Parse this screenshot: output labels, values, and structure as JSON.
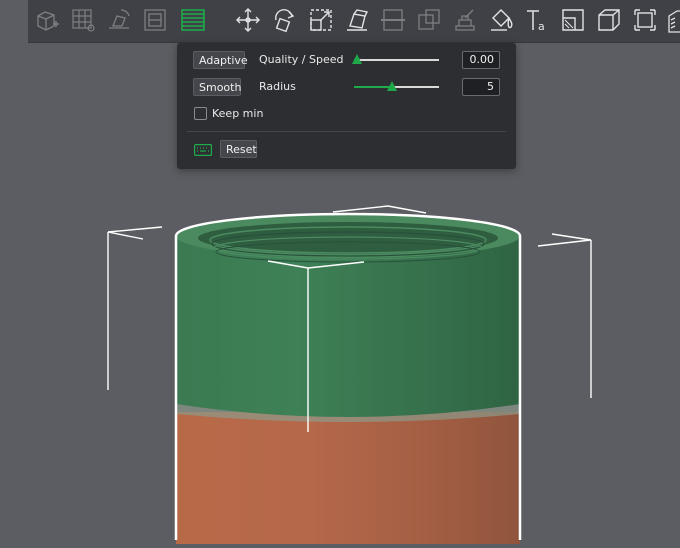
{
  "toolbar": {
    "icons": [
      "add-object-icon",
      "arrange-icon",
      "orient-icon",
      "layers-icon",
      "variable-layer-height-icon",
      "move-icon",
      "rotate-icon",
      "scale-icon",
      "lay-on-face-icon",
      "cut-icon",
      "boolean-icon",
      "support-paint-icon",
      "color-paint-icon",
      "text-icon",
      "seam-paint-icon",
      "assembly-icon",
      "measure-icon",
      "fuzzy-skin-icon"
    ],
    "active_icon": "variable-layer-height-icon"
  },
  "panel": {
    "adaptive_label": "Adaptive",
    "quality_label": "Quality / Speed",
    "quality_value": "0.00",
    "quality_fraction": 0.03,
    "smooth_label": "Smooth",
    "radius_label": "Radius",
    "radius_value": "5",
    "radius_fraction": 0.45,
    "keep_min_label": "Keep min",
    "keep_min_checked": false,
    "reset_label": "Reset"
  },
  "colors": {
    "accent": "#1faa4b",
    "model_top": "#3b7a52",
    "model_bottom": "#b86a48",
    "background": "#5c5d62"
  }
}
